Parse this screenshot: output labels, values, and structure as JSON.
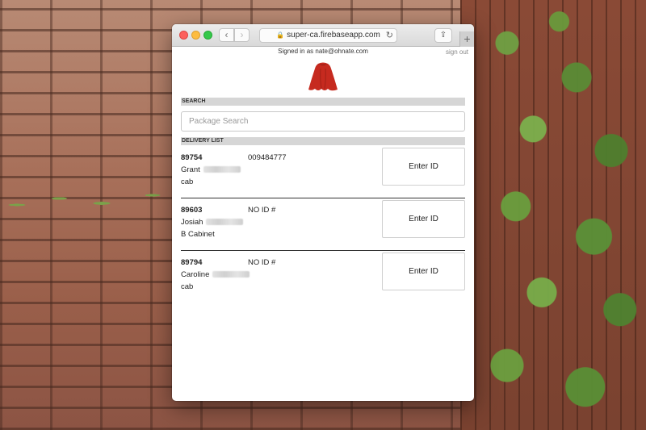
{
  "browser": {
    "url": "super-ca.firebaseapp.com"
  },
  "account": {
    "signed_in_text": "Signed in as nate@ohnate.com",
    "sign_out_label": "sign out"
  },
  "search": {
    "section_label": "SEARCH",
    "placeholder": "Package Search",
    "value": ""
  },
  "delivery": {
    "section_label": "DELIVERY LIST",
    "items": [
      {
        "id": "89754",
        "id_number": "009484777",
        "name": "Grant",
        "location": "cab",
        "button_label": "Enter ID"
      },
      {
        "id": "89603",
        "id_number": "NO ID #",
        "name": "Josiah",
        "location": "B Cabinet",
        "button_label": "Enter ID"
      },
      {
        "id": "89794",
        "id_number": "NO ID #",
        "name": "Caroline",
        "location": "cab",
        "button_label": "Enter ID"
      }
    ]
  },
  "colors": {
    "logo": "#c62a1f",
    "section_header_bg": "#d6d6d6"
  }
}
